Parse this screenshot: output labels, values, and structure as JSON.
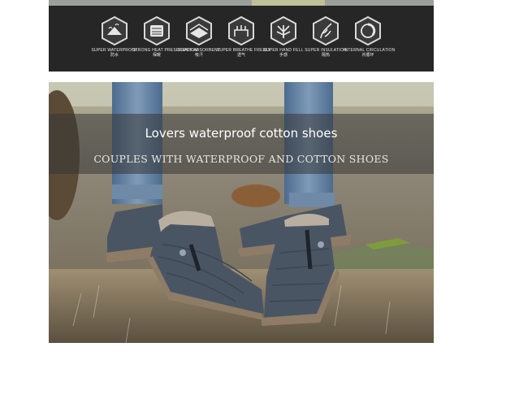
{
  "features": [
    {
      "title": "SUPER WATERPROOF",
      "cn": "防水",
      "icon": "waterproof-icon"
    },
    {
      "title": "STRONG HEAT PRESERVATION",
      "cn": "保暖",
      "icon": "heat-preservation-icon"
    },
    {
      "title": "SUPER ABSORBENT",
      "cn": "吸汗",
      "icon": "absorbent-icon"
    },
    {
      "title": "SUPER BREATHE FREELY",
      "cn": "透气",
      "icon": "breathable-icon"
    },
    {
      "title": "SUPER HAND FELL",
      "cn": "手感",
      "icon": "hand-feel-icon"
    },
    {
      "title": "SUPER INSULATION",
      "cn": "隔热",
      "icon": "insulation-icon"
    },
    {
      "title": "INTERNAL CIRCULATION",
      "cn": "内循环",
      "icon": "circulation-icon"
    }
  ],
  "banner": {
    "title": "Lovers waterproof cotton shoes",
    "subtitle": "COUPLES WITH WATERPROOF AND COTTON SHOES"
  },
  "colors": {
    "feature_bar": "#262626",
    "shoe": "#4a5564",
    "fur": "#b9aea0",
    "sole": "#8e7c67"
  }
}
